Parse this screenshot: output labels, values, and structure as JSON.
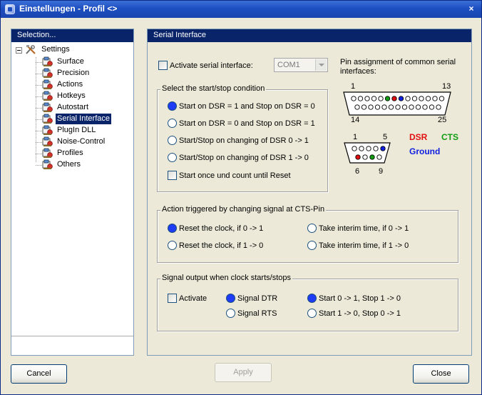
{
  "window": {
    "title": "Einstellungen - Profil <>",
    "close_glyph": "×"
  },
  "left_panel": {
    "header": "Selection...",
    "root_label": "Settings",
    "items": [
      {
        "label": "Surface"
      },
      {
        "label": "Precision"
      },
      {
        "label": "Actions"
      },
      {
        "label": "Hotkeys"
      },
      {
        "label": "Autostart"
      },
      {
        "label": "Serial Interface",
        "selected": true
      },
      {
        "label": "PlugIn DLL"
      },
      {
        "label": "Noise-Control"
      },
      {
        "label": "Profiles"
      },
      {
        "label": "Others"
      }
    ]
  },
  "right_panel": {
    "header": "Serial Interface",
    "activate_label": "Activate serial interface:",
    "port_value": "COM1",
    "pin_heading": "Pin assignment of common serial interfaces:",
    "db25": {
      "pin_1": "1",
      "pin_13": "13",
      "pin_14": "14",
      "pin_25": "25"
    },
    "db9": {
      "pin_1": "1",
      "pin_5": "5",
      "pin_6": "6",
      "pin_9": "9"
    },
    "legend": {
      "dsr": "DSR",
      "cts": "CTS",
      "ground": "Ground"
    },
    "colors": {
      "dsr": "#e21010",
      "cts": "#119d11",
      "ground": "#1020e0"
    },
    "startstop": {
      "title": "Select the start/stop condition",
      "options": [
        "Start on DSR = 1 and Stop on DSR = 0",
        "Start on DSR = 0 and Stop on DSR = 1",
        "Start/Stop  on changing of DSR 0 -> 1",
        "Start/Stop  on changing of DSR 1 -> 0"
      ],
      "selected": 0,
      "count_label": "Start once und count until Reset"
    },
    "cts": {
      "title": "Action triggered by changing signal at CTS-Pin",
      "opt_reset_01": "Reset the clock, if 0 -> 1",
      "opt_reset_10": "Reset the clock, if 1 -> 0",
      "opt_interim_01": "Take interim time, if 0 -> 1",
      "opt_interim_10": "Take interim time, if 1 -> 0"
    },
    "signal": {
      "title": "Signal output when clock starts/stops",
      "activate": "Activate",
      "dtr": "Signal DTR",
      "rts": "Signal RTS",
      "start01": "Start 0 -> 1, Stop 1 -> 0",
      "start10": "Start 1 -> 0, Stop 0 -> 1"
    }
  },
  "buttons": {
    "cancel": "Cancel",
    "apply": "Apply",
    "close": "Close"
  }
}
